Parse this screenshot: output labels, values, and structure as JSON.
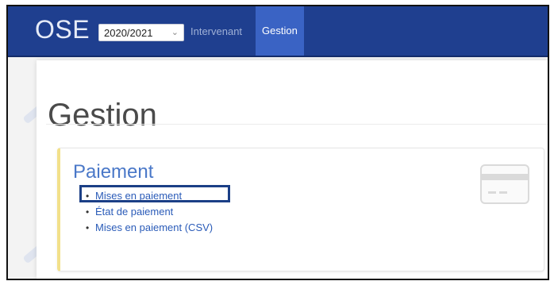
{
  "app": {
    "brand": "OSE"
  },
  "toolbar": {
    "year_select_value": "2020/2021",
    "nav": [
      {
        "label": "Intervenant",
        "active": false
      },
      {
        "label": "Gestion",
        "active": true
      }
    ]
  },
  "page": {
    "title": "Gestion"
  },
  "card": {
    "title": "Paiement",
    "items": [
      {
        "label": "Mises en paiement"
      },
      {
        "label": "État de paiement"
      },
      {
        "label": "Mises en paiement (CSV)"
      }
    ],
    "icon": "credit-card-icon"
  },
  "colors": {
    "navbar": "#1f3f8f",
    "active_nav": "#3a63c4",
    "link": "#2a5bb8",
    "card_accent": "#f2e08a",
    "highlight_border": "#1b3f86"
  }
}
